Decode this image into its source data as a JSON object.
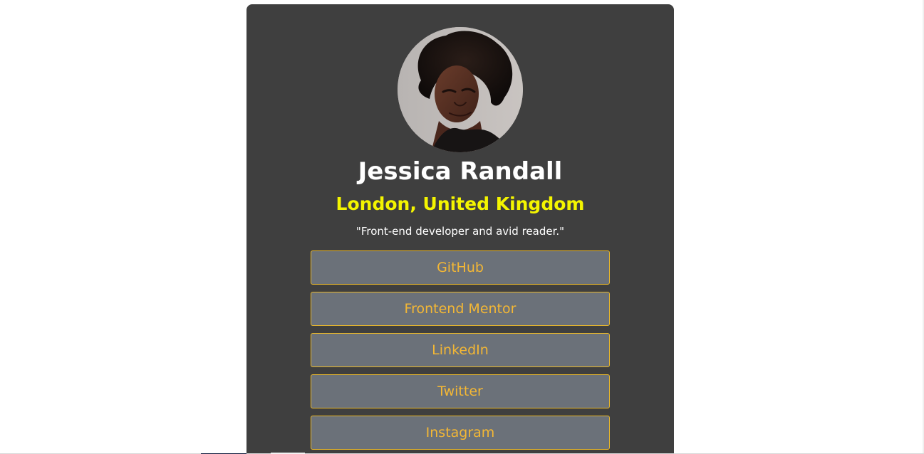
{
  "profile": {
    "name": "Jessica Randall",
    "location": "London, United Kingdom",
    "bio": "\"Front-end developer and avid reader.\""
  },
  "links": [
    {
      "label": "GitHub"
    },
    {
      "label": "Frontend Mentor"
    },
    {
      "label": "LinkedIn"
    },
    {
      "label": "Twitter"
    },
    {
      "label": "Instagram"
    }
  ],
  "colors": {
    "page_background": "#ffffff",
    "card_background": "#3f3f3f",
    "name_color": "#ffffff",
    "location_color": "#f4f500",
    "button_background": "#6b7179",
    "button_border": "#e8b72b",
    "button_text": "#f3b735"
  }
}
